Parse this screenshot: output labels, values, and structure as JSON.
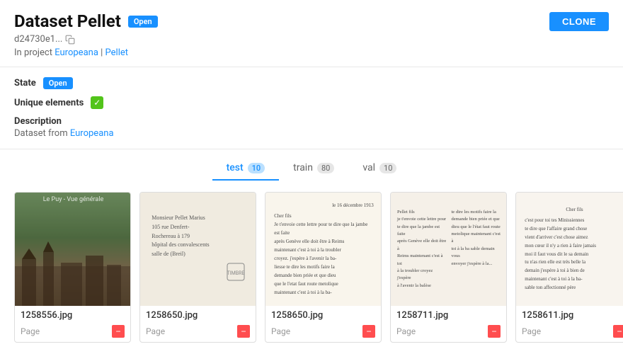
{
  "header": {
    "title": "Dataset Pellet",
    "badge": "Open",
    "clone_label": "CLONE",
    "id_text": "d24730e1...",
    "in_project_prefix": "In project",
    "project_links": [
      {
        "label": "Europeana",
        "href": "#"
      },
      {
        "label": "Pellet",
        "href": "#"
      }
    ]
  },
  "meta": {
    "state_label": "State",
    "state_value": "Open",
    "unique_label": "Unique elements",
    "desc_label": "Description",
    "desc_text": "Dataset from",
    "desc_link": "Europeana"
  },
  "tabs": [
    {
      "id": "test",
      "label": "test",
      "count": "10",
      "active": true
    },
    {
      "id": "train",
      "label": "train",
      "count": "80",
      "active": false
    },
    {
      "id": "val",
      "label": "val",
      "count": "10",
      "active": false
    }
  ],
  "images": [
    {
      "id": "img1",
      "name": "1258556.jpg",
      "tag": "Page",
      "type": "photo"
    },
    {
      "id": "img2",
      "name": "1258650.jpg",
      "tag": "Page",
      "type": "postcard"
    },
    {
      "id": "img3",
      "name": "1258650.jpg",
      "tag": "Page",
      "type": "letter"
    },
    {
      "id": "img4",
      "name": "1258711.jpg",
      "tag": "Page",
      "type": "letter2"
    },
    {
      "id": "img5",
      "name": "1258611.jpg",
      "tag": "Page",
      "type": "letter3"
    }
  ],
  "icons": {
    "copy": "⧉",
    "check": "✓",
    "minus": "−"
  }
}
